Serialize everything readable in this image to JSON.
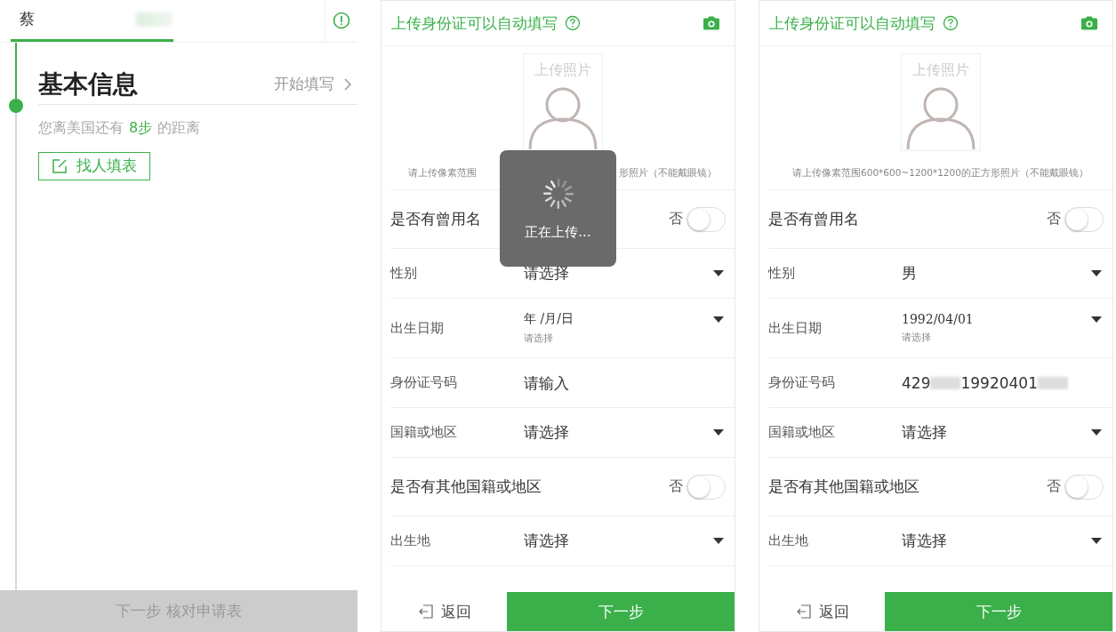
{
  "left": {
    "tab": {
      "label": "蔡",
      "redacted": true,
      "selected": true
    },
    "section": {
      "title": "基本信息",
      "action": "开始填写",
      "progress_before": "您离美国还有",
      "progress_steps": "8步",
      "progress_after": "的距离",
      "helper_button": "找人填表"
    },
    "footer_button": {
      "label": "下一步 核对申请表",
      "disabled": true
    }
  },
  "forms": [
    {
      "upload_title": "上传身份证可以自动填写",
      "photo_label": "上传照片",
      "photo_hint": [
        "请上传像素范围",
        "形照片（不能戴眼镜）"
      ],
      "loading": {
        "text": "正在上传..."
      },
      "rows": [
        {
          "kind": "toggle",
          "label": "是否有曾用名",
          "value": "否",
          "on": false
        },
        {
          "kind": "select",
          "label": "性别",
          "value": "请选择"
        },
        {
          "kind": "date",
          "label": "出生日期",
          "value": "年 /月/日",
          "hint": "请选择"
        },
        {
          "kind": "input",
          "label": "身份证号码",
          "placeholder": "请输入"
        },
        {
          "kind": "select",
          "label": "国籍或地区",
          "value": "请选择"
        },
        {
          "kind": "toggle",
          "label": "是否有其他国籍或地区",
          "value": "否",
          "on": false
        },
        {
          "kind": "select",
          "label": "出生地",
          "value": "请选择"
        }
      ],
      "back_button": "返回",
      "next_button": "下一步"
    },
    {
      "upload_title": "上传身份证可以自动填写",
      "photo_label": "上传照片",
      "photo_hint": [
        "请上传像素范围600*600~1200*1200的正方形照片（不能戴眼镜）"
      ],
      "rows": [
        {
          "kind": "toggle",
          "label": "是否有曾用名",
          "value": "否",
          "on": false
        },
        {
          "kind": "select",
          "label": "性别",
          "value": "男"
        },
        {
          "kind": "date",
          "label": "出生日期",
          "value": "1992/04/01",
          "hint": "请选择"
        },
        {
          "kind": "redacted",
          "label": "身份证号码",
          "parts": [
            "429",
            "19920401"
          ]
        },
        {
          "kind": "select",
          "label": "国籍或地区",
          "value": "请选择"
        },
        {
          "kind": "toggle",
          "label": "是否有其他国籍或地区",
          "value": "否",
          "on": false
        },
        {
          "kind": "select",
          "label": "出生地",
          "value": "请选择"
        }
      ],
      "back_button": "返回",
      "next_button": "下一步"
    }
  ]
}
